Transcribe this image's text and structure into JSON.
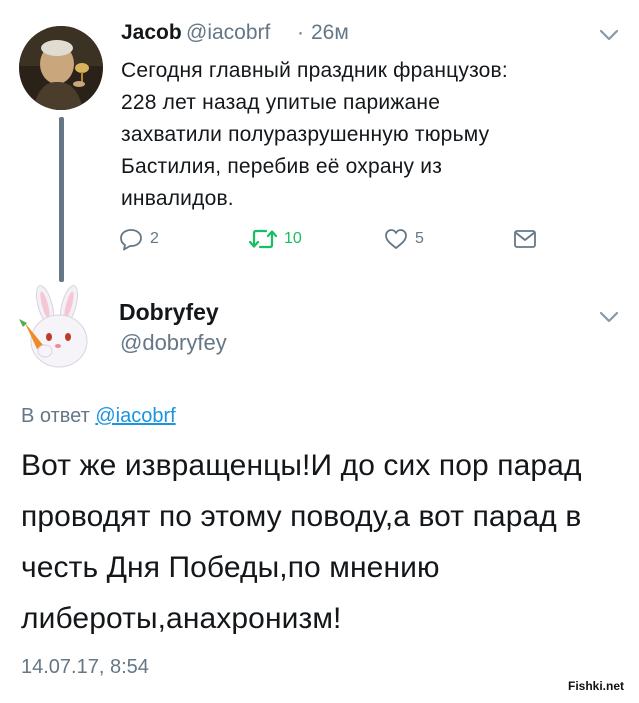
{
  "tweet1": {
    "name": "Jacob",
    "handle": "@iacobrf",
    "dot": "·",
    "time": "26м",
    "text": "Сегодня главный праздник французов:\n228 лет назад упитые парижане\nзахватили полуразрушенную тюрьму\nБастилия, перебив её охрану из\nинвалидов.",
    "actions": {
      "reply_count": "2",
      "retweet_count": "10",
      "like_count": "5"
    }
  },
  "tweet2": {
    "name": "Dobryfey",
    "handle": "@dobryfey",
    "reply_prefix": "В ответ ",
    "reply_to": "@iacobrf",
    "text": "Вот же извращенцы!И до сих пор парад проводят по этому поводу,а вот парад в честь Дня Победы,по мнению либероты,анахронизм!",
    "date": "14.07.17, 8:54"
  },
  "watermark": "Fishki.net",
  "colors": {
    "text": "#14171a",
    "secondary": "#657786",
    "link": "#1b95e0",
    "retweet": "#17bf63",
    "thread_line": "#657786"
  },
  "icons": [
    "chevron-down-icon",
    "reply-icon",
    "retweet-icon",
    "like-icon",
    "dm-icon"
  ]
}
